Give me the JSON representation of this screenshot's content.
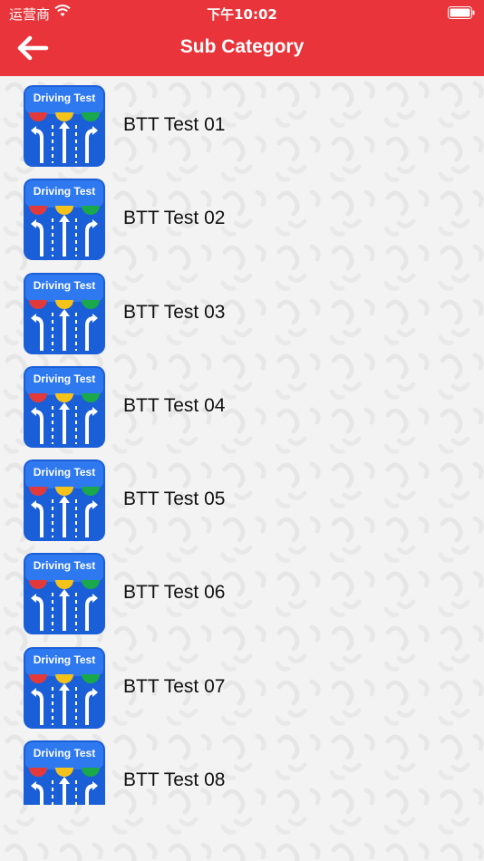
{
  "status_bar": {
    "carrier": "运营商",
    "time": "下午10:02"
  },
  "nav": {
    "title": "Sub Category",
    "back_icon": "arrow-left-icon"
  },
  "icon": {
    "label": "Driving Test",
    "name": "driving-test-app-icon"
  },
  "colors": {
    "header": "#e8343a",
    "icon_blue": "#1b5fd8",
    "light_red": "#e23a3a",
    "light_yellow": "#f5c21a",
    "light_green": "#19a84a"
  },
  "items": [
    {
      "label": "BTT Test 01"
    },
    {
      "label": "BTT Test 02"
    },
    {
      "label": "BTT Test 03"
    },
    {
      "label": "BTT Test 04"
    },
    {
      "label": "BTT Test 05"
    },
    {
      "label": "BTT Test 06"
    },
    {
      "label": "BTT Test 07"
    },
    {
      "label": "BTT Test 08"
    }
  ]
}
